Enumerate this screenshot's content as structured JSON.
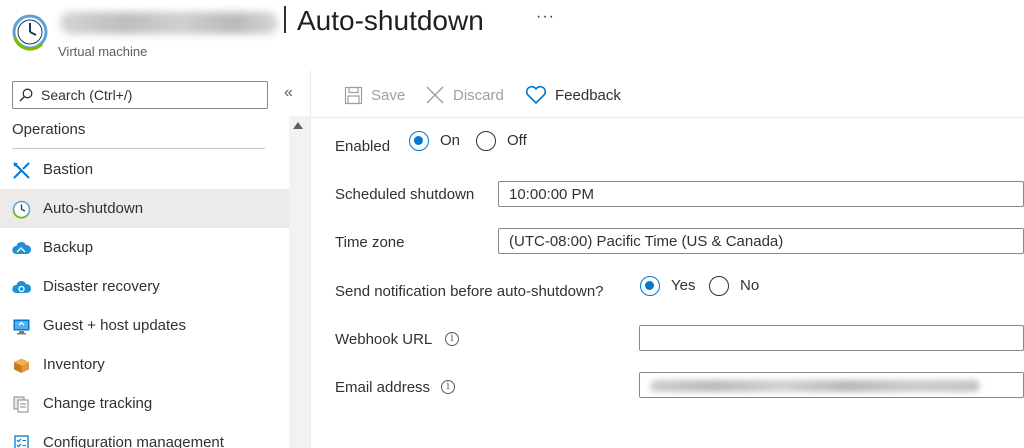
{
  "header": {
    "resource_name": "devfarkd35dbf1-1",
    "blade_title": "Auto-shutdown",
    "more_label": "···",
    "subtitle": "Virtual machine"
  },
  "sidebar": {
    "search_placeholder": "Search (Ctrl+/)",
    "collapse_label": "«",
    "section_title": "Operations",
    "items": [
      {
        "label": "Bastion",
        "icon": "bastion-icon",
        "active": false
      },
      {
        "label": "Auto-shutdown",
        "icon": "clock-icon",
        "active": true
      },
      {
        "label": "Backup",
        "icon": "backup-cloud-icon",
        "active": false
      },
      {
        "label": "Disaster recovery",
        "icon": "disaster-recovery-cloud-icon",
        "active": false
      },
      {
        "label": "Guest + host updates",
        "icon": "updates-monitor-icon",
        "active": false
      },
      {
        "label": "Inventory",
        "icon": "inventory-boxes-icon",
        "active": false
      },
      {
        "label": "Change tracking",
        "icon": "change-tracking-icon",
        "active": false
      },
      {
        "label": "Configuration management",
        "icon": "configuration-icon",
        "active": false
      }
    ]
  },
  "toolbar": {
    "save_label": "Save",
    "discard_label": "Discard",
    "feedback_label": "Feedback"
  },
  "form": {
    "enabled_label": "Enabled",
    "enabled_on_label": "On",
    "enabled_off_label": "Off",
    "enabled_value": "On",
    "scheduled_label": "Scheduled shutdown",
    "scheduled_value": "10:00:00 PM",
    "timezone_label": "Time zone",
    "timezone_value": "(UTC-08:00) Pacific Time (US & Canada)",
    "notify_label": "Send notification before auto-shutdown?",
    "notify_yes_label": "Yes",
    "notify_no_label": "No",
    "notify_value": "Yes",
    "webhook_label": "Webhook URL",
    "webhook_value": "",
    "email_label": "Email address",
    "email_value": "someone@microsoft.com;example@microsoft.com"
  },
  "colors": {
    "accent": "#0078d4",
    "active_nav_bg": "#edebe9",
    "disabled_text": "#a19f9d"
  }
}
